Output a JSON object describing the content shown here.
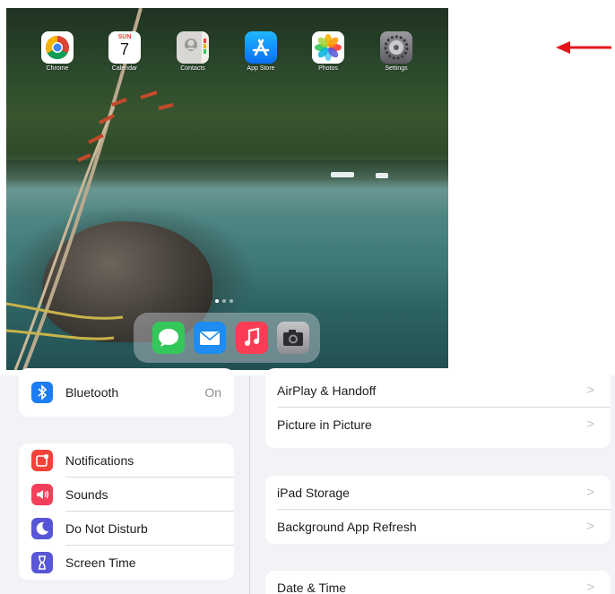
{
  "home": {
    "apps": [
      {
        "label": "Chrome",
        "icon": "chrome-icon"
      },
      {
        "label": "Calendar",
        "icon": "calendar-icon",
        "day": "SUN",
        "date": "7"
      },
      {
        "label": "Contacts",
        "icon": "contacts-icon"
      },
      {
        "label": "App Store",
        "icon": "app-store-icon"
      },
      {
        "label": "Photos",
        "icon": "photos-icon"
      },
      {
        "label": "Settings",
        "icon": "settings-icon"
      }
    ],
    "dock": [
      {
        "icon": "messages-icon",
        "color": "#34c759"
      },
      {
        "icon": "mail-icon",
        "color": "#1e8cf0"
      },
      {
        "icon": "music-icon",
        "color": "#fa3c55"
      },
      {
        "icon": "camera-icon",
        "color": "#8e8e93"
      }
    ],
    "page_count": 3,
    "current_page": 1
  },
  "annotation": {
    "arrow_color": "#e0161b",
    "points_to": "Settings"
  },
  "settings": {
    "left_groups": [
      [
        {
          "label": "Bluetooth",
          "value": "On",
          "icon": "bluetooth-icon",
          "color": "#1e7cf2"
        }
      ],
      [
        {
          "label": "Notifications",
          "icon": "notifications-icon",
          "color": "#f2423a"
        },
        {
          "label": "Sounds",
          "icon": "sounds-icon",
          "color": "#f2405a"
        },
        {
          "label": "Do Not Disturb",
          "icon": "moon-icon",
          "color": "#5856d6"
        },
        {
          "label": "Screen Time",
          "icon": "hourglass-icon",
          "color": "#5856d6"
        }
      ]
    ],
    "right_groups": [
      [
        {
          "label": "AirPlay & Handoff"
        },
        {
          "label": "Picture in Picture"
        }
      ],
      [
        {
          "label": "iPad Storage"
        },
        {
          "label": "Background App Refresh"
        }
      ],
      [
        {
          "label": "Date & Time"
        }
      ]
    ],
    "chevron": ">"
  }
}
